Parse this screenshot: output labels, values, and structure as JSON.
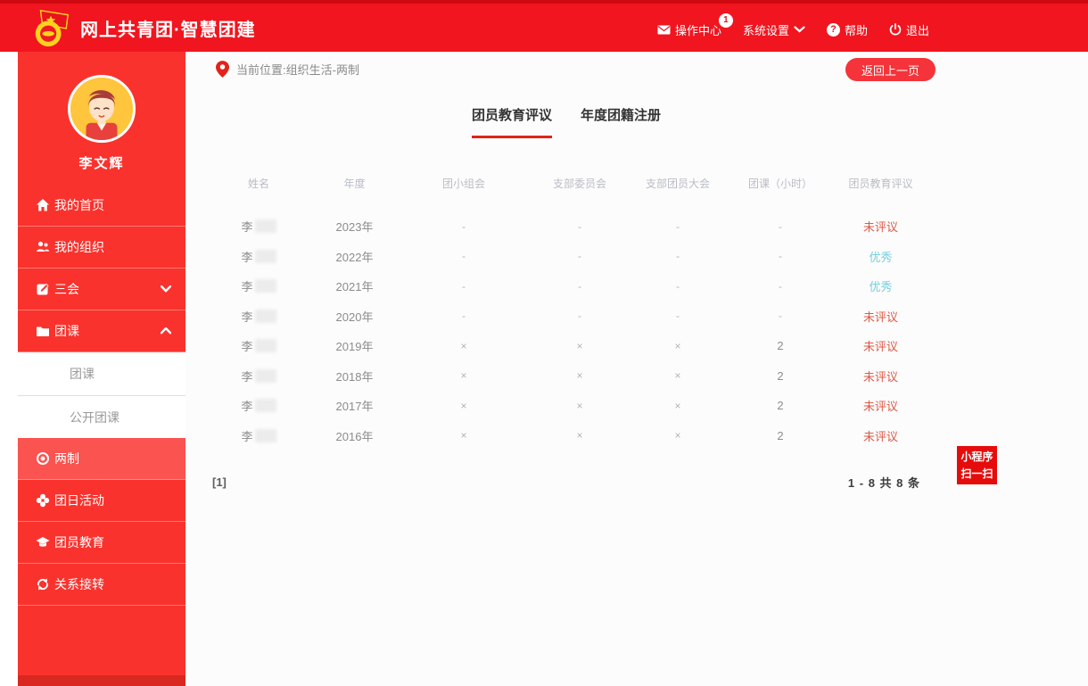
{
  "header": {
    "title": "网上共青团·智慧团建",
    "nav": [
      {
        "label": "操作中心",
        "icon": "mail-icon",
        "badge": "1"
      },
      {
        "label": "系统设置",
        "icon": "chevron-down-icon"
      },
      {
        "label": "帮助",
        "icon": "question-icon",
        "glyph": "?"
      },
      {
        "label": "退出",
        "icon": "power-icon"
      }
    ]
  },
  "sidebar": {
    "username": "李文辉",
    "menu": [
      {
        "label": "我的首页",
        "icon": "home-icon"
      },
      {
        "label": "我的组织",
        "icon": "users-icon"
      },
      {
        "label": "三会",
        "icon": "edit-icon",
        "chevron": "down"
      },
      {
        "label": "团课",
        "icon": "folder-icon",
        "chevron": "up"
      }
    ],
    "submenu": [
      {
        "label": "团课"
      },
      {
        "label": "公开团课"
      }
    ],
    "menu2": [
      {
        "label": "两制",
        "icon": "target-icon",
        "active": true
      },
      {
        "label": "团日活动",
        "icon": "activity-icon"
      },
      {
        "label": "团员教育",
        "icon": "education-icon"
      },
      {
        "label": "关系接转",
        "icon": "transfer-icon"
      }
    ]
  },
  "main": {
    "breadcrumb": "当前位置:组织生活-两制",
    "back_button": "返回上一页",
    "tabs": [
      {
        "label": "团员教育评议",
        "active": true
      },
      {
        "label": "年度团籍注册",
        "active": false
      }
    ],
    "table": {
      "headers": [
        "姓名",
        "年度",
        "团小组会",
        "支部委员会",
        "支部团员大会",
        "团课（小时）",
        "团员教育评议"
      ],
      "rows": [
        {
          "name": "李",
          "name_censored": true,
          "year": "2023年",
          "group_meeting": "-",
          "committee": "-",
          "branch_meeting": "-",
          "course_hours": "-",
          "review": "未评议",
          "review_type": "pending"
        },
        {
          "name": "李",
          "name_censored": true,
          "year": "2022年",
          "group_meeting": "-",
          "committee": "-",
          "branch_meeting": "-",
          "course_hours": "-",
          "review": "优秀",
          "review_type": "excellent"
        },
        {
          "name": "李",
          "name_censored": true,
          "year": "2021年",
          "group_meeting": "-",
          "committee": "-",
          "branch_meeting": "-",
          "course_hours": "-",
          "review": "优秀",
          "review_type": "excellent"
        },
        {
          "name": "李",
          "name_censored": true,
          "year": "2020年",
          "group_meeting": "-",
          "committee": "-",
          "branch_meeting": "-",
          "course_hours": "-",
          "review": "未评议",
          "review_type": "pending"
        },
        {
          "name": "李",
          "name_censored": true,
          "year": "2019年",
          "group_meeting": "×",
          "committee": "×",
          "branch_meeting": "×",
          "course_hours": "2",
          "review": "未评议",
          "review_type": "pending"
        },
        {
          "name": "李",
          "name_censored": true,
          "year": "2018年",
          "group_meeting": "×",
          "committee": "×",
          "branch_meeting": "×",
          "course_hours": "2",
          "review": "未评议",
          "review_type": "pending"
        },
        {
          "name": "李",
          "name_censored": true,
          "year": "2017年",
          "group_meeting": "×",
          "committee": "×",
          "branch_meeting": "×",
          "course_hours": "2",
          "review": "未评议",
          "review_type": "pending"
        },
        {
          "name": "李",
          "name_censored": true,
          "year": "2016年",
          "group_meeting": "×",
          "committee": "×",
          "branch_meeting": "×",
          "course_hours": "2",
          "review": "未评议",
          "review_type": "pending"
        }
      ]
    },
    "pagination": {
      "page": "[1]",
      "summary": "1 - 8 共 8 条"
    },
    "mini_program_badge": {
      "line1": "小程序",
      "line2": "扫一扫"
    }
  },
  "colors": {
    "header_red": "#f0151f",
    "sidebar_red": "#fa322d",
    "active_item_red": "#fb5350",
    "button_red": "#f4343a",
    "badge_red": "#e60c0c",
    "tab_underline_red": "#e2231a",
    "status_pending": "#dd5a49",
    "status_excellent": "#74cfe0"
  }
}
